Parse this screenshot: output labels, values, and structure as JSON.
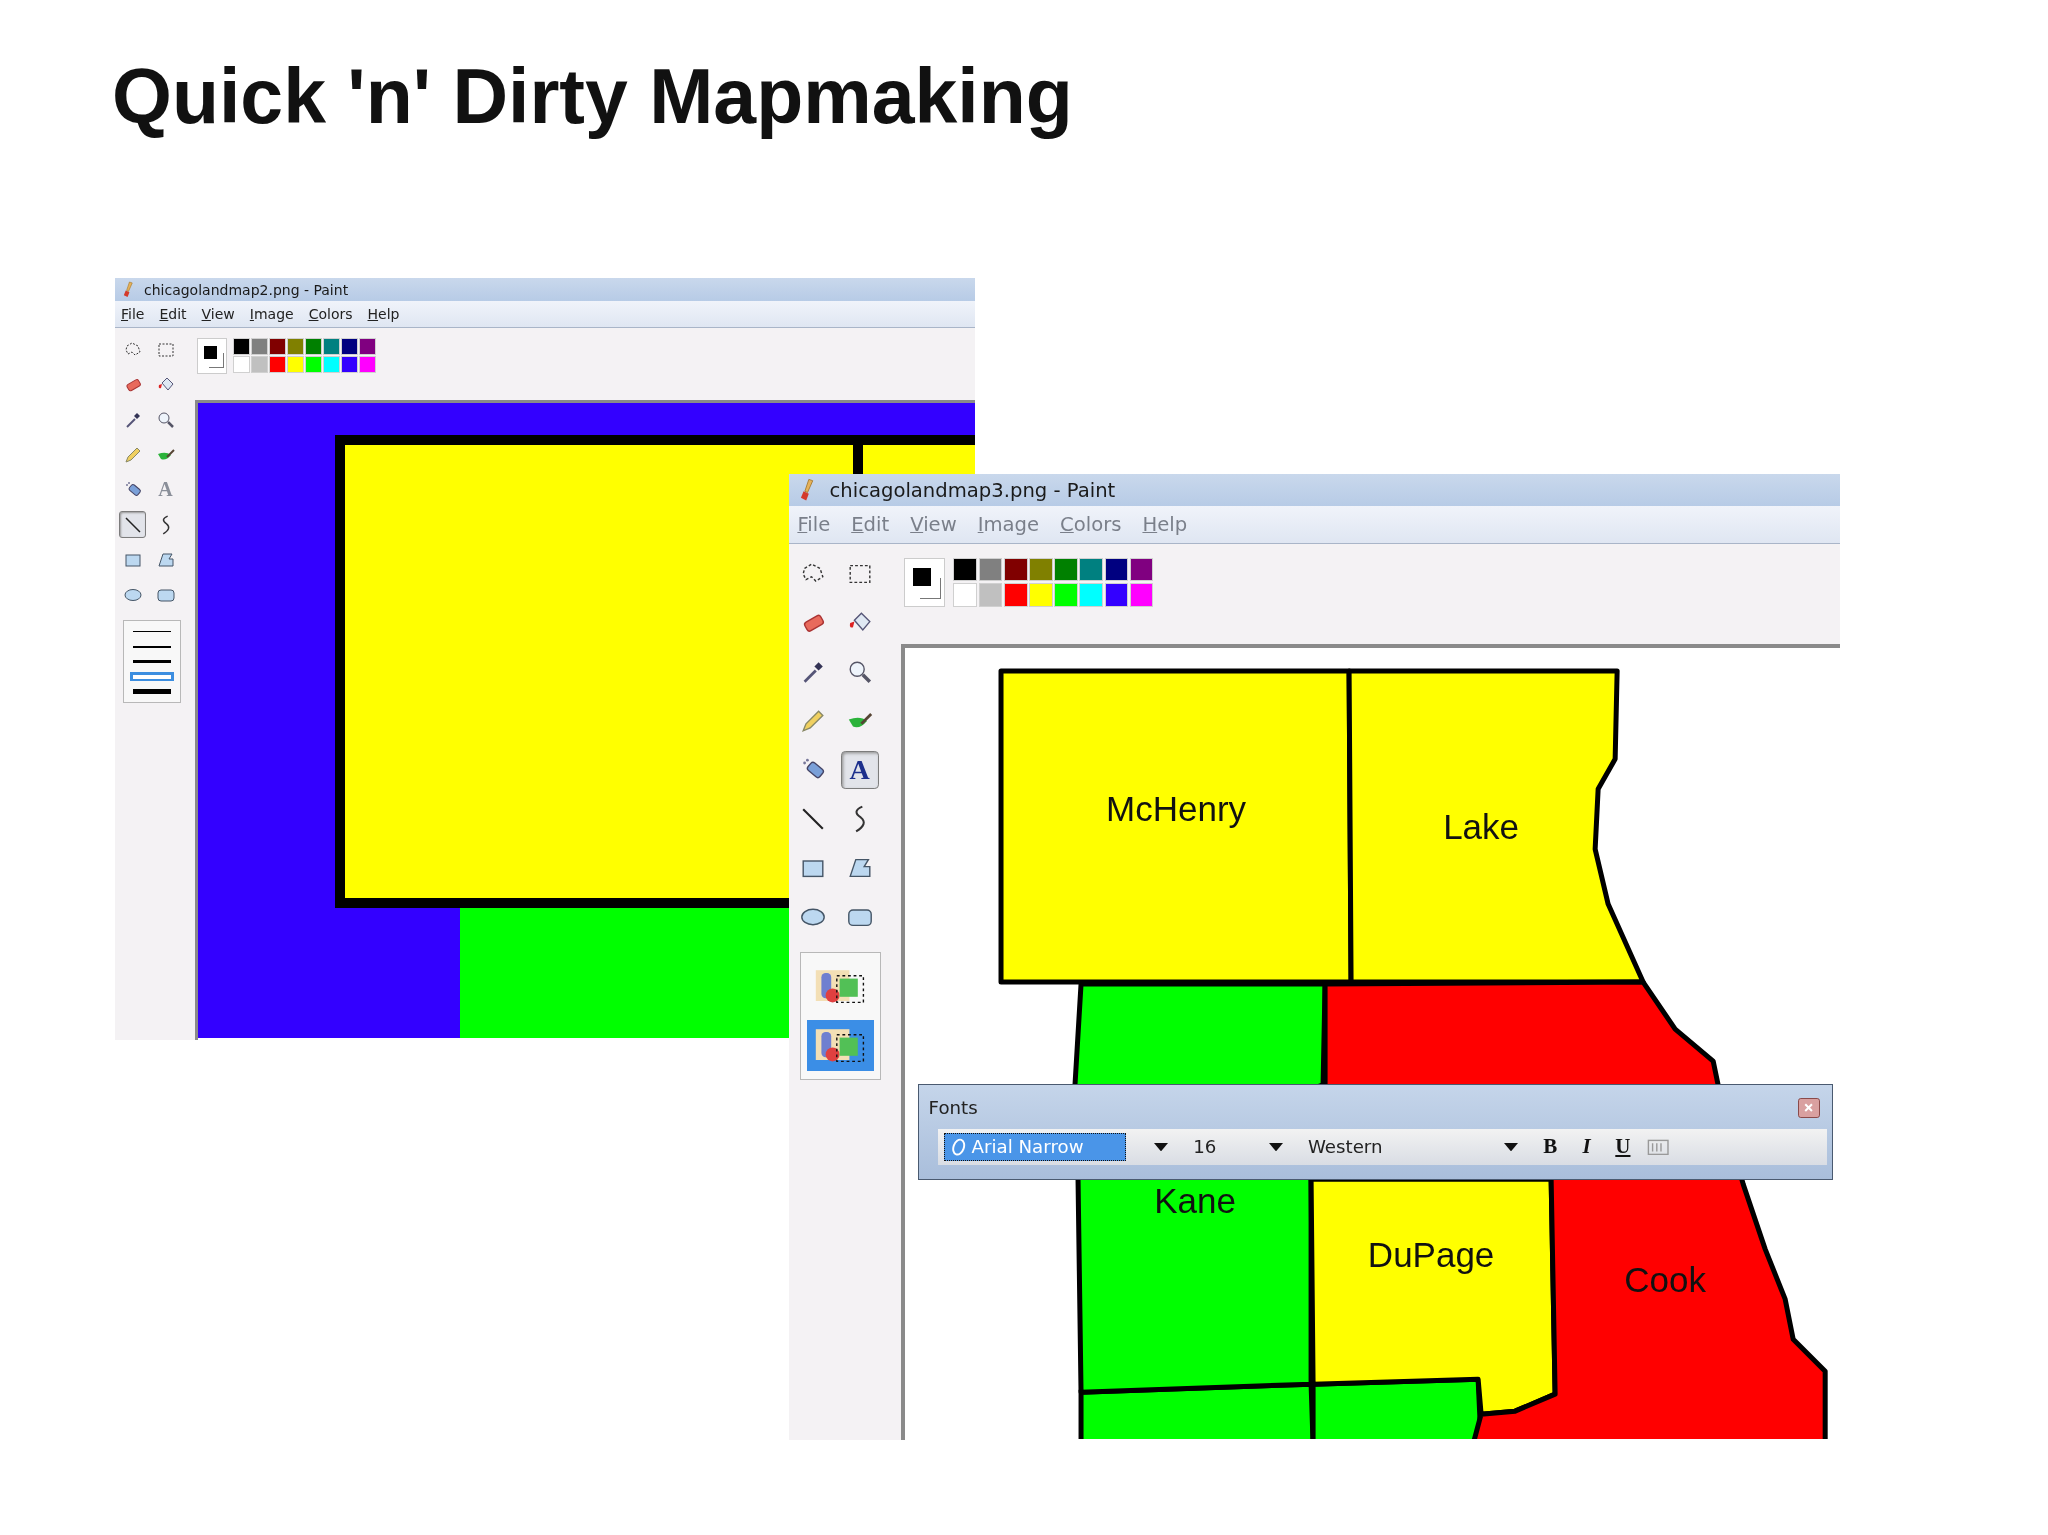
{
  "slide_title": "Quick 'n' Dirty Mapmaking",
  "windows": [
    {
      "title": "chicagolandmap2.png - Paint",
      "menu": [
        "File",
        "Edit",
        "View",
        "Image",
        "Colors",
        "Help"
      ],
      "tools": [
        {
          "kind": "free-select",
          "selected": false
        },
        {
          "kind": "rect-select",
          "selected": false
        },
        {
          "kind": "eraser",
          "selected": false
        },
        {
          "kind": "fill",
          "selected": false
        },
        {
          "kind": "picker",
          "selected": false
        },
        {
          "kind": "magnifier",
          "selected": false
        },
        {
          "kind": "pencil",
          "selected": false
        },
        {
          "kind": "brush",
          "selected": false
        },
        {
          "kind": "airbrush",
          "selected": false
        },
        {
          "kind": "text",
          "glyph": "A",
          "selected": false
        },
        {
          "kind": "line",
          "selected": true
        },
        {
          "kind": "curve",
          "selected": false
        },
        {
          "kind": "rectangle",
          "selected": false
        },
        {
          "kind": "polygon",
          "selected": false
        },
        {
          "kind": "ellipse",
          "selected": false
        },
        {
          "kind": "rounded-rect",
          "selected": false
        }
      ],
      "options": {
        "kind": "line-width",
        "items": [
          {
            "selected": false
          },
          {
            "selected": false
          },
          {
            "selected": false
          },
          {
            "selected": true
          },
          {
            "selected": false
          }
        ]
      },
      "palette": [
        {
          "color": "#000000"
        },
        {
          "color": "#808080"
        },
        {
          "color": "#800000"
        },
        {
          "color": "#808000"
        },
        {
          "color": "#008000"
        },
        {
          "color": "#008080"
        },
        {
          "color": "#000080"
        },
        {
          "color": "#800080"
        },
        {
          "color": "#ffffff"
        },
        {
          "color": "#c0c0c0"
        },
        {
          "color": "#ff0000"
        },
        {
          "color": "#ffff00"
        },
        {
          "color": "#00ff00"
        },
        {
          "color": "#00ffff"
        },
        {
          "color": "#3300ff"
        },
        {
          "color": "#ff00ff"
        }
      ],
      "canvas": {
        "kind": "blocks"
      }
    },
    {
      "title": "chicagolandmap3.png - Paint",
      "menu": [
        "File",
        "Edit",
        "View",
        "Image",
        "Colors",
        "Help"
      ],
      "tools": [
        {
          "kind": "free-select",
          "selected": false
        },
        {
          "kind": "rect-select",
          "selected": false
        },
        {
          "kind": "eraser",
          "selected": false
        },
        {
          "kind": "fill",
          "selected": false
        },
        {
          "kind": "picker",
          "selected": false
        },
        {
          "kind": "magnifier",
          "selected": false
        },
        {
          "kind": "pencil",
          "selected": false
        },
        {
          "kind": "brush",
          "selected": false
        },
        {
          "kind": "airbrush",
          "selected": false
        },
        {
          "kind": "text",
          "glyph": "A",
          "selected": true
        },
        {
          "kind": "line",
          "selected": false
        },
        {
          "kind": "curve",
          "selected": false
        },
        {
          "kind": "rectangle",
          "selected": false
        },
        {
          "kind": "polygon",
          "selected": false
        },
        {
          "kind": "ellipse",
          "selected": false
        },
        {
          "kind": "rounded-rect",
          "selected": false
        }
      ],
      "options": {
        "kind": "transparency",
        "items": [
          {
            "selected": false
          },
          {
            "selected": true
          }
        ]
      },
      "palette": [
        {
          "color": "#000000"
        },
        {
          "color": "#808080"
        },
        {
          "color": "#800000"
        },
        {
          "color": "#808000"
        },
        {
          "color": "#008000"
        },
        {
          "color": "#008080"
        },
        {
          "color": "#000080"
        },
        {
          "color": "#800080"
        },
        {
          "color": "#ffffff"
        },
        {
          "color": "#c0c0c0"
        },
        {
          "color": "#ff0000"
        },
        {
          "color": "#ffff00"
        },
        {
          "color": "#00ff00"
        },
        {
          "color": "#00ffff"
        },
        {
          "color": "#3300ff"
        },
        {
          "color": "#ff00ff"
        }
      ],
      "canvas": {
        "kind": "map",
        "counties": [
          {
            "name": "McHenry",
            "color": "#ffff00"
          },
          {
            "name": "Lake",
            "color": "#ffff00"
          },
          {
            "name": "Kane",
            "color": "#00ff00"
          },
          {
            "name": "DuPage",
            "color": "#ffff00"
          },
          {
            "name": "Cook",
            "color": "#ff0000"
          }
        ]
      },
      "fonts_toolbar": {
        "title": "Fonts",
        "font": "Arial Narrow",
        "size": "16",
        "script": "Western",
        "styles": [
          {
            "kind": "bold",
            "label": "B"
          },
          {
            "kind": "italic",
            "label": "I"
          },
          {
            "kind": "underline",
            "label": "U"
          }
        ]
      }
    }
  ]
}
